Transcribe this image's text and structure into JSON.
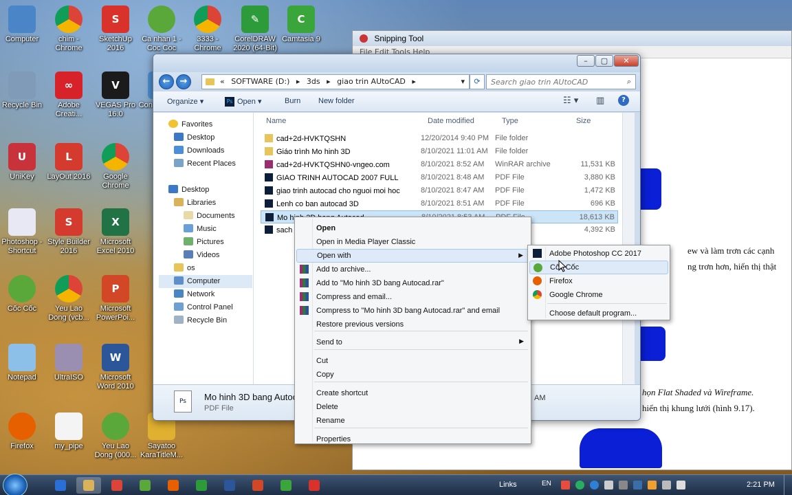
{
  "desktop_icons": [
    {
      "label": "Computer",
      "icon": "computer-icon",
      "color": "#4a86c7",
      "glyph": ""
    },
    {
      "label": "chim - Chrome",
      "icon": "chrome-icon",
      "color": "#db4437",
      "glyph": ""
    },
    {
      "label": "SketchUp 2016",
      "icon": "sketchup-icon",
      "color": "#d9322a",
      "glyph": "S"
    },
    {
      "label": "Ca nhan 1 - Coc Coc",
      "icon": "coccoc-icon",
      "color": "#5aa83a",
      "glyph": ""
    },
    {
      "label": "3333 - Chrome",
      "icon": "chrome-icon",
      "color": "#db4437",
      "glyph": ""
    },
    {
      "label": "CorelDRAW 2020 (64-Bit)",
      "icon": "coreldraw-icon",
      "color": "#2e9b3a",
      "glyph": "✎"
    },
    {
      "label": "Camtasia 9",
      "icon": "camtasia-icon",
      "color": "#3aa53a",
      "glyph": "C"
    },
    {
      "label": "Recycle Bin",
      "icon": "recycle-bin-icon",
      "color": "#7f9bb8",
      "glyph": ""
    },
    {
      "label": "Adobe Creati...",
      "icon": "adobe-cc-icon",
      "color": "#d8222a",
      "glyph": "∞"
    },
    {
      "label": "VEGAS Pro 16.0",
      "icon": "vegas-icon",
      "color": "#1b1b1b",
      "glyph": "V"
    },
    {
      "label": "Control Panel",
      "icon": "control-panel-icon",
      "color": "#4b8fd0",
      "glyph": ""
    },
    {
      "label": "UniKey",
      "icon": "unikey-icon",
      "color": "#c8323a",
      "glyph": "U"
    },
    {
      "label": "LayOut 2016",
      "icon": "layout-icon",
      "color": "#d53a2e",
      "glyph": "L"
    },
    {
      "label": "Google Chrome",
      "icon": "chrome-icon",
      "color": "#db4437",
      "glyph": ""
    },
    {
      "label": "Photoshop - Shortcut",
      "icon": "calendar-icon",
      "color": "#e8e8f4",
      "glyph": ""
    },
    {
      "label": "Style Builder 2016",
      "icon": "stylebuilder-icon",
      "color": "#d53a2e",
      "glyph": "S"
    },
    {
      "label": "Microsoft Excel 2010",
      "icon": "excel-icon",
      "color": "#217346",
      "glyph": "X"
    },
    {
      "label": "Cốc Cốc",
      "icon": "coccoc-icon",
      "color": "#5aa83a",
      "glyph": ""
    },
    {
      "label": "Yeu Lao Dong (vcb...",
      "icon": "chrome-icon",
      "color": "#db4437",
      "glyph": ""
    },
    {
      "label": "Microsoft PowerPoi...",
      "icon": "powerpoint-icon",
      "color": "#d24726",
      "glyph": "P"
    },
    {
      "label": "Notepad",
      "icon": "notepad-icon",
      "color": "#8cc0e8",
      "glyph": ""
    },
    {
      "label": "UltraISO",
      "icon": "ultraiso-icon",
      "color": "#9a8fb0",
      "glyph": ""
    },
    {
      "label": "Microsoft Word 2010",
      "icon": "word-icon",
      "color": "#2b579a",
      "glyph": "W"
    },
    {
      "label": "Firefox",
      "icon": "firefox-icon",
      "color": "#e66000",
      "glyph": ""
    },
    {
      "label": "my_pipe",
      "icon": "file-icon",
      "color": "#f4f4f4",
      "glyph": ""
    },
    {
      "label": "Yeu Lao Dong (000...",
      "icon": "coccoc-icon",
      "color": "#5aa83a",
      "glyph": ""
    },
    {
      "label": "Sayatoo KaraTitleM...",
      "icon": "sayatoo-icon",
      "color": "#e0b030",
      "glyph": ""
    }
  ],
  "snipping": {
    "title": "Snipping Tool",
    "menu": "File   Edit   Tools   Help",
    "text1": "ew và làm trơn các cạnh",
    "text2": "ng trơn hơn, hiển thị thật",
    "text3": "họn Flat Shaded và Wireframe.",
    "text4": "hiển thị khung lưới (hình 9.17)."
  },
  "explorer": {
    "breadcrumb_prefix": "«",
    "breadcrumb": [
      "SOFTWARE (D:)",
      "3ds",
      "giao trin AUtoCAD"
    ],
    "search_placeholder": "Search giao trin AUtoCAD",
    "toolbar": {
      "organize": "Organize ▾",
      "open": "Open ▾",
      "burn": "Burn",
      "new_folder": "New folder"
    },
    "nav": {
      "favorites": "Favorites",
      "desktop": "Desktop",
      "downloads": "Downloads",
      "recent": "Recent Places",
      "desktop_root": "Desktop",
      "libraries": "Libraries",
      "documents": "Documents",
      "music": "Music",
      "pictures": "Pictures",
      "videos": "Videos",
      "os": "os",
      "computer": "Computer",
      "network": "Network",
      "control_panel": "Control Panel",
      "recycle_bin": "Recycle Bin"
    },
    "columns": {
      "name": "Name",
      "date": "Date modified",
      "type": "Type",
      "size": "Size"
    },
    "files": [
      {
        "name": "cad+2d-HVKTQSHN",
        "date": "12/20/2014 9:40 PM",
        "type": "File folder",
        "size": "",
        "icon": "folder-icon"
      },
      {
        "name": "Giáo trình Mo hinh 3D",
        "date": "8/10/2021 11:01 AM",
        "type": "File folder",
        "size": "",
        "icon": "folder-icon"
      },
      {
        "name": "cad+2d-HVKTQSHN0-vngeo.com",
        "date": "8/10/2021 8:52 AM",
        "type": "WinRAR archive",
        "size": "11,531 KB",
        "icon": "winrar-icon"
      },
      {
        "name": "GIAO TRINH AUTOCAD 2007 FULL",
        "date": "8/10/2021 8:48 AM",
        "type": "PDF File",
        "size": "3,880 KB",
        "icon": "pdf-icon"
      },
      {
        "name": "giao trinh autocad cho nguoi moi hoc",
        "date": "8/10/2021 8:47 AM",
        "type": "PDF File",
        "size": "1,472 KB",
        "icon": "pdf-icon"
      },
      {
        "name": "Lenh co ban autocad 3D",
        "date": "8/10/2021 8:51 AM",
        "type": "PDF File",
        "size": "696 KB",
        "icon": "pdf-icon"
      },
      {
        "name": "Mo hinh 3D bang Autocad",
        "date": "8/10/2021 8:53 AM",
        "type": "PDF File",
        "size": "18,613 KB",
        "icon": "pdf-icon"
      },
      {
        "name": "sach",
        "date": "",
        "type": "",
        "size": "4,392 KB",
        "icon": "pdf-icon"
      }
    ],
    "details_name": "Mo hinh 3D bang Autoca",
    "details_type": "PDF File",
    "details_time": "AM"
  },
  "context_menu": [
    {
      "label": "Open",
      "bold": true,
      "icon": ""
    },
    {
      "label": "Open in Media Player Classic",
      "icon": ""
    },
    {
      "label": "Open with",
      "icon": "",
      "submenu": true
    },
    {
      "label": "Add to archive...",
      "icon": "winrar-icon"
    },
    {
      "label": "Add to \"Mo hinh 3D bang Autocad.rar\"",
      "icon": "winrar-icon"
    },
    {
      "label": "Compress and email...",
      "icon": "winrar-icon"
    },
    {
      "label": "Compress to \"Mo hinh 3D bang Autocad.rar\" and email",
      "icon": "winrar-icon"
    },
    {
      "label": "Restore previous versions",
      "icon": ""
    },
    {
      "label": "Send to",
      "icon": "",
      "submenu": true
    },
    {
      "label": "Cut",
      "icon": ""
    },
    {
      "label": "Copy",
      "icon": ""
    },
    {
      "label": "Create shortcut",
      "icon": ""
    },
    {
      "label": "Delete",
      "icon": ""
    },
    {
      "label": "Rename",
      "icon": ""
    },
    {
      "label": "Properties",
      "icon": ""
    }
  ],
  "open_with_menu": [
    {
      "label": "Adobe Photoshop CC 2017",
      "icon": "photoshop-icon",
      "color": "#0c1e3a"
    },
    {
      "label": "Cốc Cốc",
      "icon": "coccoc-icon",
      "color": "#5aa83a"
    },
    {
      "label": "Firefox",
      "icon": "firefox-icon",
      "color": "#e66000"
    },
    {
      "label": "Google Chrome",
      "icon": "chrome-icon",
      "color": "#db4437"
    },
    {
      "label": "Choose default program...",
      "icon": "",
      "color": ""
    }
  ],
  "taskbar": {
    "links": "Links",
    "lang": "EN",
    "time": "2:21 PM"
  }
}
